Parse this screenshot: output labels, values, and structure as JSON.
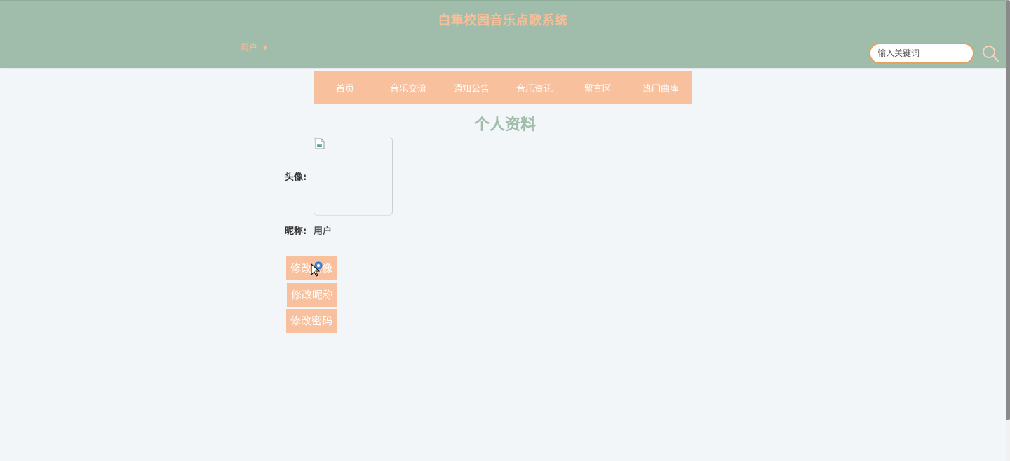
{
  "header": {
    "site_title": "白隼校园音乐点歌系统",
    "user_menu_label": "用户",
    "search_placeholder": "输入关键词"
  },
  "nav": {
    "items": [
      {
        "label": "首页"
      },
      {
        "label": "音乐交流"
      },
      {
        "label": "通知公告"
      },
      {
        "label": "音乐资讯"
      },
      {
        "label": "留言区"
      },
      {
        "label": "热门曲库"
      }
    ]
  },
  "profile": {
    "page_title": "个人资料",
    "avatar_label": "头像:",
    "nickname_label": "昵称:",
    "nickname_value": "用户"
  },
  "actions": {
    "change_avatar": "修改头像",
    "change_nickname": "修改昵称",
    "change_password": "修改密码"
  },
  "colors": {
    "header_bg": "#a0bcaa",
    "accent": "#f8c09c",
    "title_text": "#f6bf9a"
  }
}
